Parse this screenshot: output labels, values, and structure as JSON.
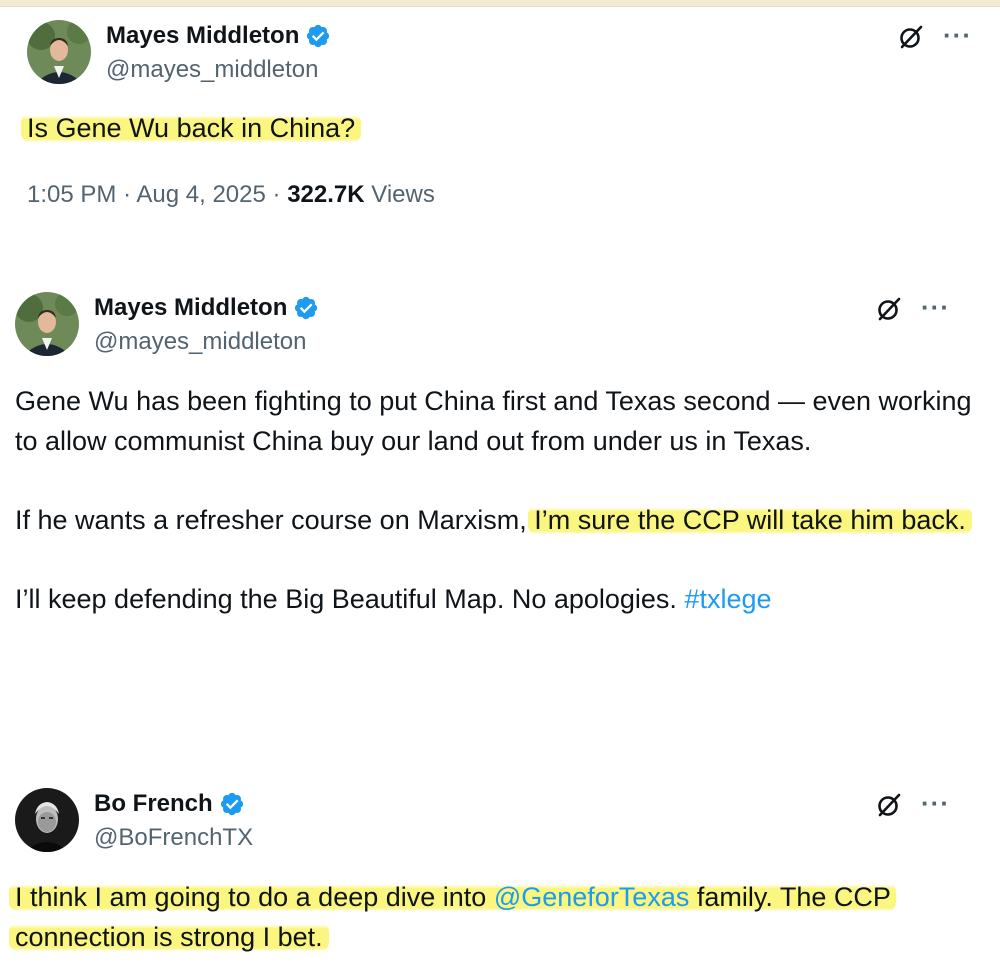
{
  "tweets": [
    {
      "name": "Mayes Middleton",
      "handle": "@mayes_middleton",
      "text": "Is Gene Wu back in China?",
      "time": "1:05 PM",
      "date": "Aug 4, 2025",
      "views_count": "322.7K",
      "views_label": "Views"
    },
    {
      "name": "Mayes Middleton",
      "handle": "@mayes_middleton",
      "para1": "Gene Wu has been fighting to put China first and Texas second — even working to allow communist China buy our land out from under us in Texas.",
      "para2_plain": "If he wants a refresher course on Marxism,",
      "para2_highlight": "I’m sure the CCP will take him back.",
      "para3_plain": "I’ll keep defending the Big Beautiful Map. No apologies.",
      "para3_hashtag": "#txlege"
    },
    {
      "name": "Bo French",
      "handle": "@BoFrenchTX",
      "text_a": "I think I am going to do a deep dive into",
      "mention": "@GeneforTexas",
      "text_b": "family. The CCP connection is strong I bet."
    }
  ],
  "icons": {
    "verified": "verified-badge-icon",
    "grok": "grok-icon",
    "more": "more-options-icon"
  },
  "colors": {
    "link": "#1d9bf0",
    "verified": "#1d9bf0",
    "highlight": "#faf56e",
    "secondary_text": "#536471"
  }
}
